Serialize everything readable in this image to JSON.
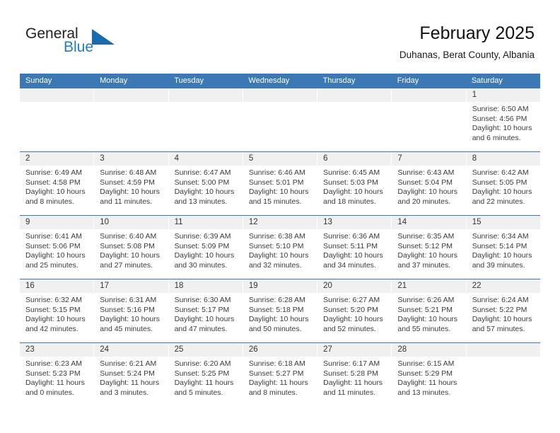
{
  "brand": {
    "name_part1": "General",
    "name_part2": "Blue",
    "logo_icon": "triangle-flag-icon",
    "accent_color": "#1a6aaf",
    "text_color": "#1f7cc4"
  },
  "header": {
    "title": "February 2025",
    "subtitle": "Duhanas, Berat County, Albania"
  },
  "theme": {
    "header_row_color": "#3c78b4",
    "day_band_color": "#f0f0f0",
    "row_divider_color": "#3c78b4"
  },
  "weekdays": [
    "Sunday",
    "Monday",
    "Tuesday",
    "Wednesday",
    "Thursday",
    "Friday",
    "Saturday"
  ],
  "weeks": [
    [
      {
        "day": "",
        "empty": true
      },
      {
        "day": "",
        "empty": true
      },
      {
        "day": "",
        "empty": true
      },
      {
        "day": "",
        "empty": true
      },
      {
        "day": "",
        "empty": true
      },
      {
        "day": "",
        "empty": true
      },
      {
        "day": "1",
        "sunrise": "Sunrise: 6:50 AM",
        "sunset": "Sunset: 4:56 PM",
        "daylight_line1": "Daylight: 10 hours",
        "daylight_line2": "and 6 minutes."
      }
    ],
    [
      {
        "day": "2",
        "sunrise": "Sunrise: 6:49 AM",
        "sunset": "Sunset: 4:58 PM",
        "daylight_line1": "Daylight: 10 hours",
        "daylight_line2": "and 8 minutes."
      },
      {
        "day": "3",
        "sunrise": "Sunrise: 6:48 AM",
        "sunset": "Sunset: 4:59 PM",
        "daylight_line1": "Daylight: 10 hours",
        "daylight_line2": "and 11 minutes."
      },
      {
        "day": "4",
        "sunrise": "Sunrise: 6:47 AM",
        "sunset": "Sunset: 5:00 PM",
        "daylight_line1": "Daylight: 10 hours",
        "daylight_line2": "and 13 minutes."
      },
      {
        "day": "5",
        "sunrise": "Sunrise: 6:46 AM",
        "sunset": "Sunset: 5:01 PM",
        "daylight_line1": "Daylight: 10 hours",
        "daylight_line2": "and 15 minutes."
      },
      {
        "day": "6",
        "sunrise": "Sunrise: 6:45 AM",
        "sunset": "Sunset: 5:03 PM",
        "daylight_line1": "Daylight: 10 hours",
        "daylight_line2": "and 18 minutes."
      },
      {
        "day": "7",
        "sunrise": "Sunrise: 6:43 AM",
        "sunset": "Sunset: 5:04 PM",
        "daylight_line1": "Daylight: 10 hours",
        "daylight_line2": "and 20 minutes."
      },
      {
        "day": "8",
        "sunrise": "Sunrise: 6:42 AM",
        "sunset": "Sunset: 5:05 PM",
        "daylight_line1": "Daylight: 10 hours",
        "daylight_line2": "and 22 minutes."
      }
    ],
    [
      {
        "day": "9",
        "sunrise": "Sunrise: 6:41 AM",
        "sunset": "Sunset: 5:06 PM",
        "daylight_line1": "Daylight: 10 hours",
        "daylight_line2": "and 25 minutes."
      },
      {
        "day": "10",
        "sunrise": "Sunrise: 6:40 AM",
        "sunset": "Sunset: 5:08 PM",
        "daylight_line1": "Daylight: 10 hours",
        "daylight_line2": "and 27 minutes."
      },
      {
        "day": "11",
        "sunrise": "Sunrise: 6:39 AM",
        "sunset": "Sunset: 5:09 PM",
        "daylight_line1": "Daylight: 10 hours",
        "daylight_line2": "and 30 minutes."
      },
      {
        "day": "12",
        "sunrise": "Sunrise: 6:38 AM",
        "sunset": "Sunset: 5:10 PM",
        "daylight_line1": "Daylight: 10 hours",
        "daylight_line2": "and 32 minutes."
      },
      {
        "day": "13",
        "sunrise": "Sunrise: 6:36 AM",
        "sunset": "Sunset: 5:11 PM",
        "daylight_line1": "Daylight: 10 hours",
        "daylight_line2": "and 34 minutes."
      },
      {
        "day": "14",
        "sunrise": "Sunrise: 6:35 AM",
        "sunset": "Sunset: 5:12 PM",
        "daylight_line1": "Daylight: 10 hours",
        "daylight_line2": "and 37 minutes."
      },
      {
        "day": "15",
        "sunrise": "Sunrise: 6:34 AM",
        "sunset": "Sunset: 5:14 PM",
        "daylight_line1": "Daylight: 10 hours",
        "daylight_line2": "and 39 minutes."
      }
    ],
    [
      {
        "day": "16",
        "sunrise": "Sunrise: 6:32 AM",
        "sunset": "Sunset: 5:15 PM",
        "daylight_line1": "Daylight: 10 hours",
        "daylight_line2": "and 42 minutes."
      },
      {
        "day": "17",
        "sunrise": "Sunrise: 6:31 AM",
        "sunset": "Sunset: 5:16 PM",
        "daylight_line1": "Daylight: 10 hours",
        "daylight_line2": "and 45 minutes."
      },
      {
        "day": "18",
        "sunrise": "Sunrise: 6:30 AM",
        "sunset": "Sunset: 5:17 PM",
        "daylight_line1": "Daylight: 10 hours",
        "daylight_line2": "and 47 minutes."
      },
      {
        "day": "19",
        "sunrise": "Sunrise: 6:28 AM",
        "sunset": "Sunset: 5:18 PM",
        "daylight_line1": "Daylight: 10 hours",
        "daylight_line2": "and 50 minutes."
      },
      {
        "day": "20",
        "sunrise": "Sunrise: 6:27 AM",
        "sunset": "Sunset: 5:20 PM",
        "daylight_line1": "Daylight: 10 hours",
        "daylight_line2": "and 52 minutes."
      },
      {
        "day": "21",
        "sunrise": "Sunrise: 6:26 AM",
        "sunset": "Sunset: 5:21 PM",
        "daylight_line1": "Daylight: 10 hours",
        "daylight_line2": "and 55 minutes."
      },
      {
        "day": "22",
        "sunrise": "Sunrise: 6:24 AM",
        "sunset": "Sunset: 5:22 PM",
        "daylight_line1": "Daylight: 10 hours",
        "daylight_line2": "and 57 minutes."
      }
    ],
    [
      {
        "day": "23",
        "sunrise": "Sunrise: 6:23 AM",
        "sunset": "Sunset: 5:23 PM",
        "daylight_line1": "Daylight: 11 hours",
        "daylight_line2": "and 0 minutes."
      },
      {
        "day": "24",
        "sunrise": "Sunrise: 6:21 AM",
        "sunset": "Sunset: 5:24 PM",
        "daylight_line1": "Daylight: 11 hours",
        "daylight_line2": "and 3 minutes."
      },
      {
        "day": "25",
        "sunrise": "Sunrise: 6:20 AM",
        "sunset": "Sunset: 5:25 PM",
        "daylight_line1": "Daylight: 11 hours",
        "daylight_line2": "and 5 minutes."
      },
      {
        "day": "26",
        "sunrise": "Sunrise: 6:18 AM",
        "sunset": "Sunset: 5:27 PM",
        "daylight_line1": "Daylight: 11 hours",
        "daylight_line2": "and 8 minutes."
      },
      {
        "day": "27",
        "sunrise": "Sunrise: 6:17 AM",
        "sunset": "Sunset: 5:28 PM",
        "daylight_line1": "Daylight: 11 hours",
        "daylight_line2": "and 11 minutes."
      },
      {
        "day": "28",
        "sunrise": "Sunrise: 6:15 AM",
        "sunset": "Sunset: 5:29 PM",
        "daylight_line1": "Daylight: 11 hours",
        "daylight_line2": "and 13 minutes."
      },
      {
        "day": "",
        "empty": true
      }
    ]
  ]
}
